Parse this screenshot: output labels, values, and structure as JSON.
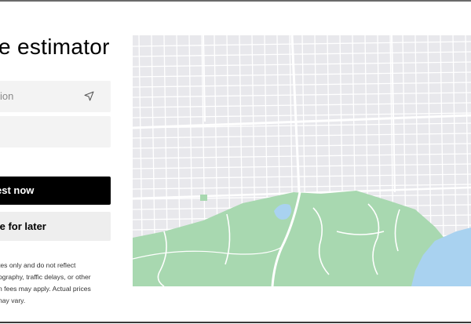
{
  "page": {
    "title": "e estimator"
  },
  "form": {
    "pickup_text": "ion",
    "destination_text": "",
    "request_label": "est now",
    "schedule_label": "le for later"
  },
  "disclaimer": {
    "lines": [
      "tes only and do not reflect",
      "ography, traffic delays, or other",
      "n fees may apply. Actual prices",
      "nay vary."
    ]
  },
  "icons": {
    "pickup_action": "navigation-arrow-icon"
  },
  "colors": {
    "map_background": "#e8e8ec",
    "park_green": "#a8d8b0",
    "water_blue": "#a9d2f0",
    "street_white": "#ffffff",
    "button_primary": "#000000",
    "button_secondary": "#eeeeee"
  }
}
